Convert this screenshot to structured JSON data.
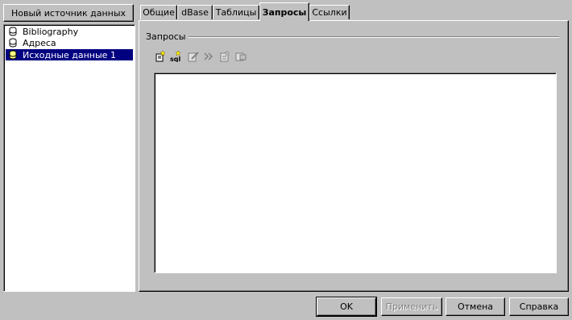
{
  "left": {
    "new_source_button": "Новый источник данных",
    "sources": [
      {
        "label": "Bibliography",
        "selected": false,
        "icon": "database-icon"
      },
      {
        "label": "Адреса",
        "selected": false,
        "icon": "database-icon"
      },
      {
        "label": "Исходные данные 1",
        "selected": true,
        "icon": "database-icon"
      }
    ]
  },
  "tabs": [
    {
      "label": "Общие",
      "active": false
    },
    {
      "label": "dBase",
      "active": false
    },
    {
      "label": "Таблицы",
      "active": false
    },
    {
      "label": "Запросы",
      "active": true
    },
    {
      "label": "Ссылки",
      "active": false
    }
  ],
  "queries": {
    "group_label": "Запросы",
    "toolbar_icons": [
      "new-query-icon",
      "new-sql-query-icon",
      "edit-query-icon",
      "open-query-icon",
      "rename-query-icon",
      "delete-query-icon"
    ]
  },
  "footer": {
    "ok": "OK",
    "apply": "Применить",
    "cancel": "Отмена",
    "help": "Справка"
  },
  "colors": {
    "face": "#c0c0c0",
    "selection": "#000080",
    "window": "#ffffff"
  }
}
